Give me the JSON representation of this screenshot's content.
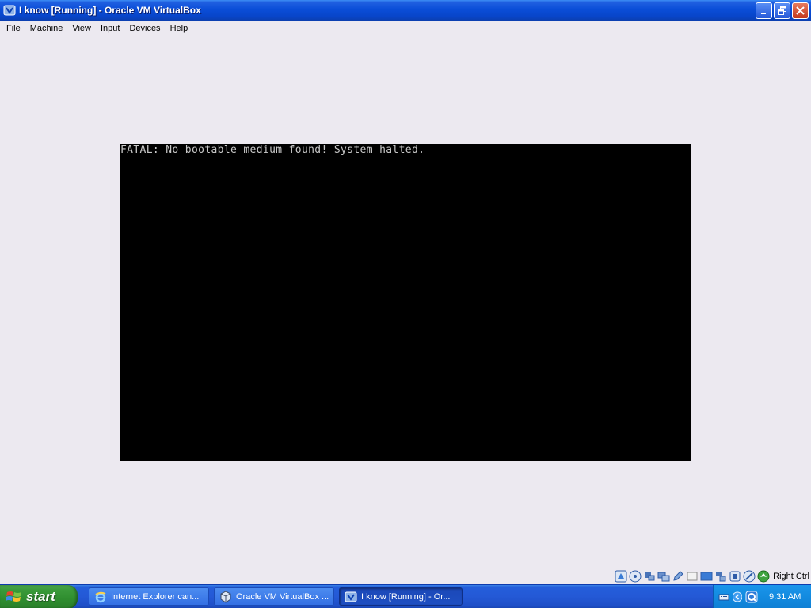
{
  "window": {
    "title": "I know [Running] - Oracle VM VirtualBox",
    "icon": "virtualbox-icon"
  },
  "menu": {
    "items": [
      {
        "label": "File"
      },
      {
        "label": "Machine"
      },
      {
        "label": "View"
      },
      {
        "label": "Input"
      },
      {
        "label": "Devices"
      },
      {
        "label": "Help"
      }
    ]
  },
  "vm": {
    "console_text": "FATAL: No bootable medium found! System halted."
  },
  "statusbar": {
    "indicators": [
      "hard-disk-icon",
      "optical-drive-icon",
      "usb-icon",
      "shared-folders-icon",
      "display-icon",
      "floppy-icon",
      "video-capture-icon",
      "network-icon",
      "mouse-integration-icon",
      "capture-icon",
      "host-key-icon"
    ],
    "host_key": "Right Ctrl"
  },
  "taskbar": {
    "start_label": "start",
    "tasks": [
      {
        "label": "Internet Explorer can..."
      },
      {
        "label": "Oracle VM VirtualBox ..."
      },
      {
        "label": "I know [Running] - Or..."
      }
    ],
    "clock": "9:31 AM"
  },
  "colors": {
    "titlebar": "#0A4ED8",
    "taskbar": "#245EDB",
    "start_button": "#3A9A3A",
    "tray": "#138BE0",
    "workspace": "#ECE9F0",
    "vm_screen": "#000000"
  }
}
